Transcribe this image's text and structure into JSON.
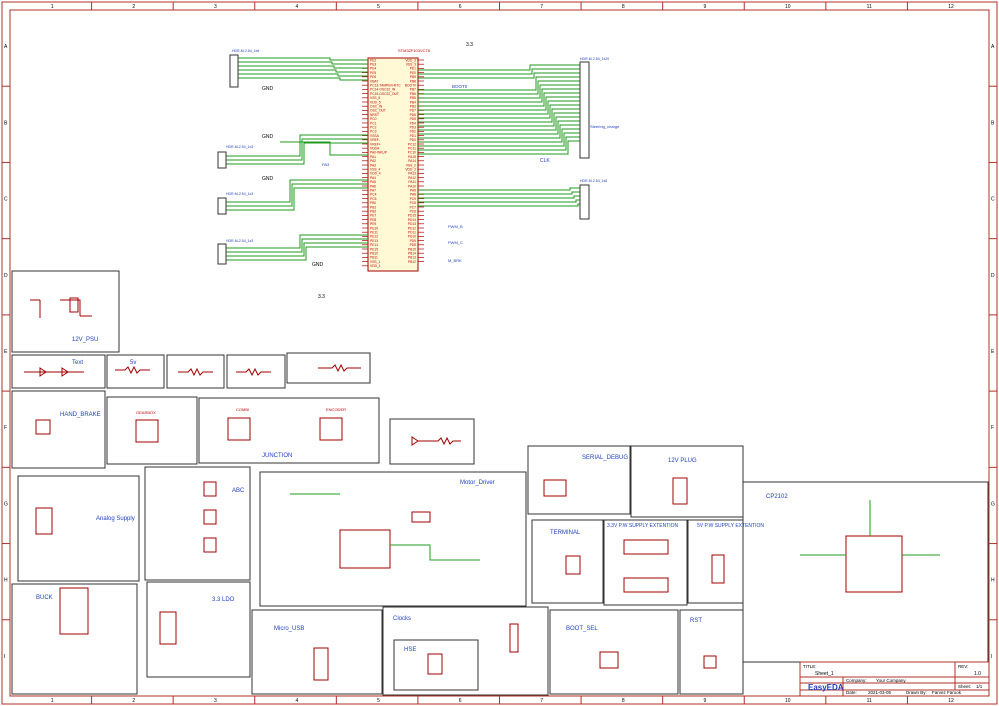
{
  "tb": {
    "title_label": "TITLE:",
    "title": "Sheet_1",
    "rev_label": "REV:",
    "rev": "1.0",
    "company_label": "Company:",
    "company": "Your Company",
    "sheet_label": "Sheet:",
    "sheet": "1/1",
    "date_label": "Date:",
    "date": "2021-03-05",
    "drawn_label": "Drawn By:",
    "drawn": "Farvez Farook",
    "logo": "EasyEDA"
  },
  "grid": {
    "cols": [
      "1",
      "2",
      "3",
      "4",
      "5",
      "6",
      "7",
      "8",
      "9",
      "10",
      "11",
      "12"
    ],
    "rows": [
      "A",
      "B",
      "C",
      "D",
      "E",
      "F",
      "G",
      "H",
      "I"
    ]
  },
  "mcu": {
    "ref": "STM32F103VCT6",
    "left_pins": [
      "PE2",
      "PE3",
      "PE4",
      "PE5",
      "PE6",
      "VBAT",
      "PC13-TAMPER-RTC",
      "PC14-OSC32_IN",
      "PC15-OSC32_OUT",
      "VSS_5",
      "VDD_5",
      "OSC_IN",
      "OSC_OUT",
      "NRST",
      "PC0",
      "PC1",
      "PC2",
      "PC3",
      "VSSA",
      "VREF-",
      "VREF+",
      "VDDA",
      "PA0-WKUP",
      "PA1",
      "PA2",
      "PA3",
      "VSS_4",
      "VDD_4",
      "PA4",
      "PA5",
      "PA6",
      "PA7",
      "PC4",
      "PC5",
      "PB0",
      "PB1",
      "PB2",
      "PE7",
      "PE8",
      "PE9",
      "PE10",
      "PE11",
      "PE12",
      "PE13",
      "PE14",
      "PE15",
      "PB10",
      "PB11",
      "VSS_1",
      "VDD_1"
    ],
    "right_pins": [
      "VDD_3",
      "VSS_3",
      "PE1",
      "PE0",
      "PB9",
      "PB8",
      "BOOT0",
      "PB7",
      "PB6",
      "PB5",
      "PB4",
      "PB3",
      "PD7",
      "PD6",
      "PD5",
      "PD4",
      "PD3",
      "PD2",
      "PD1",
      "PD0",
      "PC12",
      "PC11",
      "PC10",
      "PA15",
      "PA14",
      "VSS_2",
      "VDD_2",
      "PA13",
      "PA12",
      "PA11",
      "PA10",
      "PA9",
      "PA8",
      "PC9",
      "PC8",
      "PC7",
      "PC6",
      "PD15",
      "PD14",
      "PD13",
      "PD12",
      "PD11",
      "PD10",
      "PD9",
      "PD8",
      "PB15",
      "PB14",
      "PB13",
      "PB12"
    ]
  },
  "labels": {
    "h1": "HDR-M-2.54_1x6",
    "h2": "HDR-M-2.54_1x20",
    "h3": "HDR-M-2.54_1x3",
    "h4": "HDR-M-2.54_1x3",
    "h5": "HDR-M-2.54_1x3",
    "h6": "HDR-M-2.54_1x8",
    "v33": "3.3",
    "gnd": "GND",
    "boot0": "BOOT0",
    "steer": "Steering_charge",
    "clk": "CLK",
    "nrst": "NRST",
    "pa3": "PA3",
    "pwm_b": "PWM_B",
    "pwm_c": "PWM_C",
    "sw_bc": "SW_BC",
    "en": "ENCODER",
    "m_brk": "M_BRK",
    "vdd": "VDD_3"
  },
  "blocks": {
    "psu": "12V_PSU",
    "text": "Text",
    "v5": "5v",
    "hand": "HAND_BRAKE",
    "junction": "JUNCTION",
    "analog": "Analog Supply",
    "abc": "ABC",
    "motor": "Motor_Driver",
    "serial": "SERIAL_DEBUG",
    "plug": "12V PLUG",
    "cp2102": "CP2102",
    "terminal": "TERMINAL",
    "sup33": "3.3V P.W SUPPLY EXTENTION",
    "sup5": "5V P.W SUPPLY EXTENTION",
    "buck": "BUCK",
    "ldo": "3.3 LDO",
    "usb": "Micro_USB",
    "clocks": "Clocks",
    "hse": "HSE",
    "boot_sel": "BOOT_SEL",
    "rst": "RST",
    "gearbox": "GEARBOX",
    "combi": "COMBI",
    "encoder": "ENCODER"
  }
}
